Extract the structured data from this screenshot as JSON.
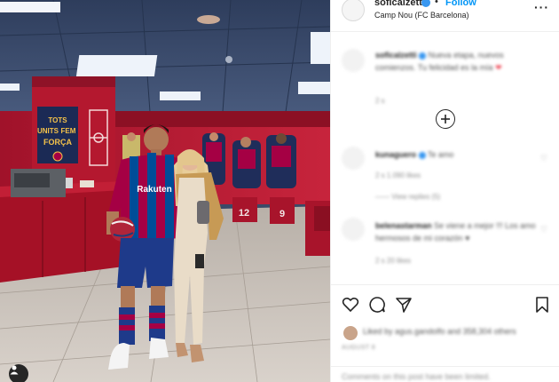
{
  "post": {
    "username": "soficalzetti",
    "follow_label": "Follow",
    "separator": "•",
    "location": "Camp Nou (FC Barcelona)",
    "more_icon": "more-options-icon"
  },
  "photo": {
    "wall_sign": [
      "TOTS",
      "UNITS",
      "FEM",
      "FORÇA"
    ],
    "shirt_text": "Rakuten",
    "bench_numbers": [
      "12",
      "9"
    ]
  },
  "comments": [
    {
      "username": "soficalzetti",
      "text": "Nueva etapa, nuevos comienzos. Tu felicidad es la mía",
      "meta": "2 s"
    },
    {
      "username": "kunaguero",
      "text": "Te amo",
      "meta": "2 s   1.090 likes",
      "reply": "——  View replies (5)"
    },
    {
      "username": "belenastarman",
      "text": "Se viene a mejor !!! Los amo hermosos de mi corazón",
      "meta": "2 s   20 likes"
    }
  ],
  "load_more_icon": "plus-circle-icon",
  "liked_by": "Liked by agus.gandolfo and 358,304 others",
  "posted_date": "AUGUST 8",
  "add_comment_placeholder": "Comments on this post have been limited.",
  "colors": {
    "accent": "#0095f6",
    "verified": "#3897f0",
    "heart": "#ed4956",
    "barca_red": "#a50044",
    "barca_blue": "#004d98"
  }
}
